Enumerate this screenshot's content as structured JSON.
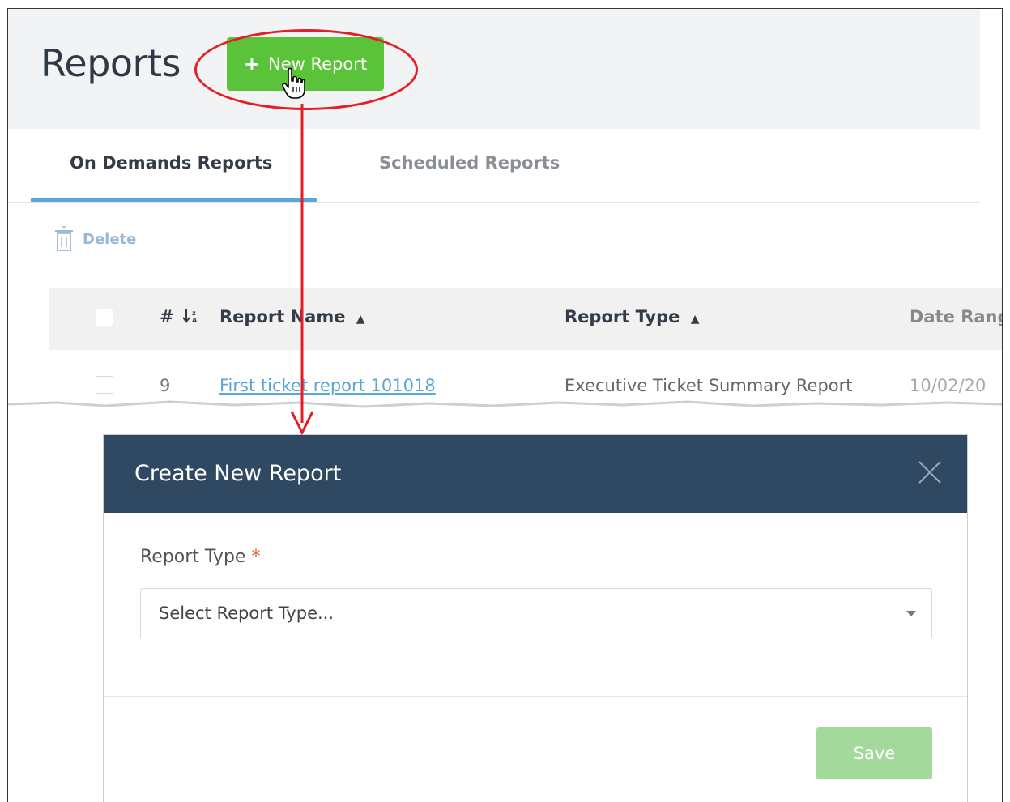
{
  "page": {
    "title": "Reports",
    "new_report_label": "New Report"
  },
  "tabs": [
    {
      "label": "On Demands Reports",
      "active": true
    },
    {
      "label": "Scheduled Reports",
      "active": false
    }
  ],
  "toolbar": {
    "delete_label": "Delete"
  },
  "table": {
    "columns": {
      "number": "#",
      "report_name": "Report Name",
      "report_type": "Report Type",
      "date_range": "Date Rang"
    },
    "rows": [
      {
        "number": "9",
        "report_name": "First ticket report 101018",
        "report_type": "Executive Ticket Summary Report",
        "date_range": "10/02/20"
      }
    ]
  },
  "modal": {
    "title": "Create New Report",
    "field_label": "Report Type",
    "required_mark": "*",
    "select_placeholder": "Select Report Type...",
    "save_label": "Save"
  },
  "colors": {
    "primary_green": "#5ac33a",
    "save_disabled": "#a3d99a",
    "modal_header": "#2e4961",
    "link_blue": "#5aa6d6",
    "annotation_red": "#e31e24"
  },
  "icons": {
    "plus": "plus-icon",
    "cursor": "hand-cursor-icon",
    "delete": "trash-icon",
    "sort": "sort-icon",
    "close": "close-icon",
    "caret": "caret-down-icon"
  }
}
